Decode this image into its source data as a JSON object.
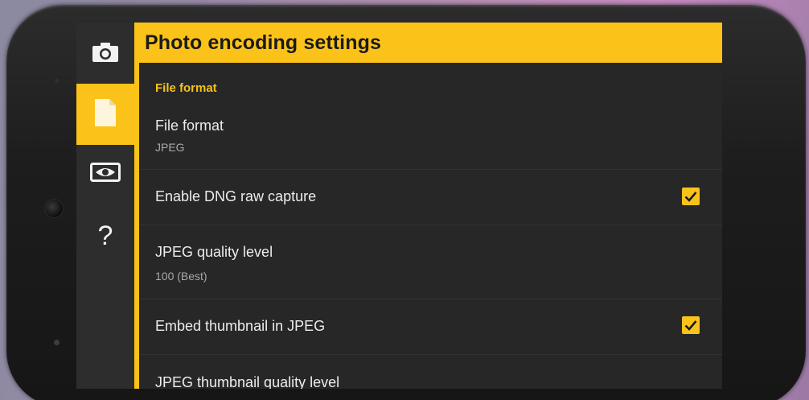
{
  "header": {
    "title": "Photo encoding settings"
  },
  "rail": {
    "items": [
      {
        "icon": "camera-icon",
        "label": ""
      },
      {
        "icon": "file-icon",
        "label": "",
        "active": true
      },
      {
        "icon": "eye-icon",
        "label": ""
      },
      {
        "icon": "help-icon",
        "label": "?"
      }
    ]
  },
  "settings": {
    "section": "File format",
    "items": [
      {
        "title": "File format",
        "summary": "JPEG"
      },
      {
        "title": "Enable DNG raw capture",
        "checked": true
      },
      {
        "title": "JPEG quality level",
        "summary": "100 (Best)"
      },
      {
        "title": "Embed thumbnail in JPEG",
        "checked": true
      },
      {
        "title": "JPEG thumbnail quality level"
      }
    ]
  },
  "colors": {
    "accent": "#fbc31a",
    "background": "#272727",
    "rail": "#2d2d2d"
  }
}
